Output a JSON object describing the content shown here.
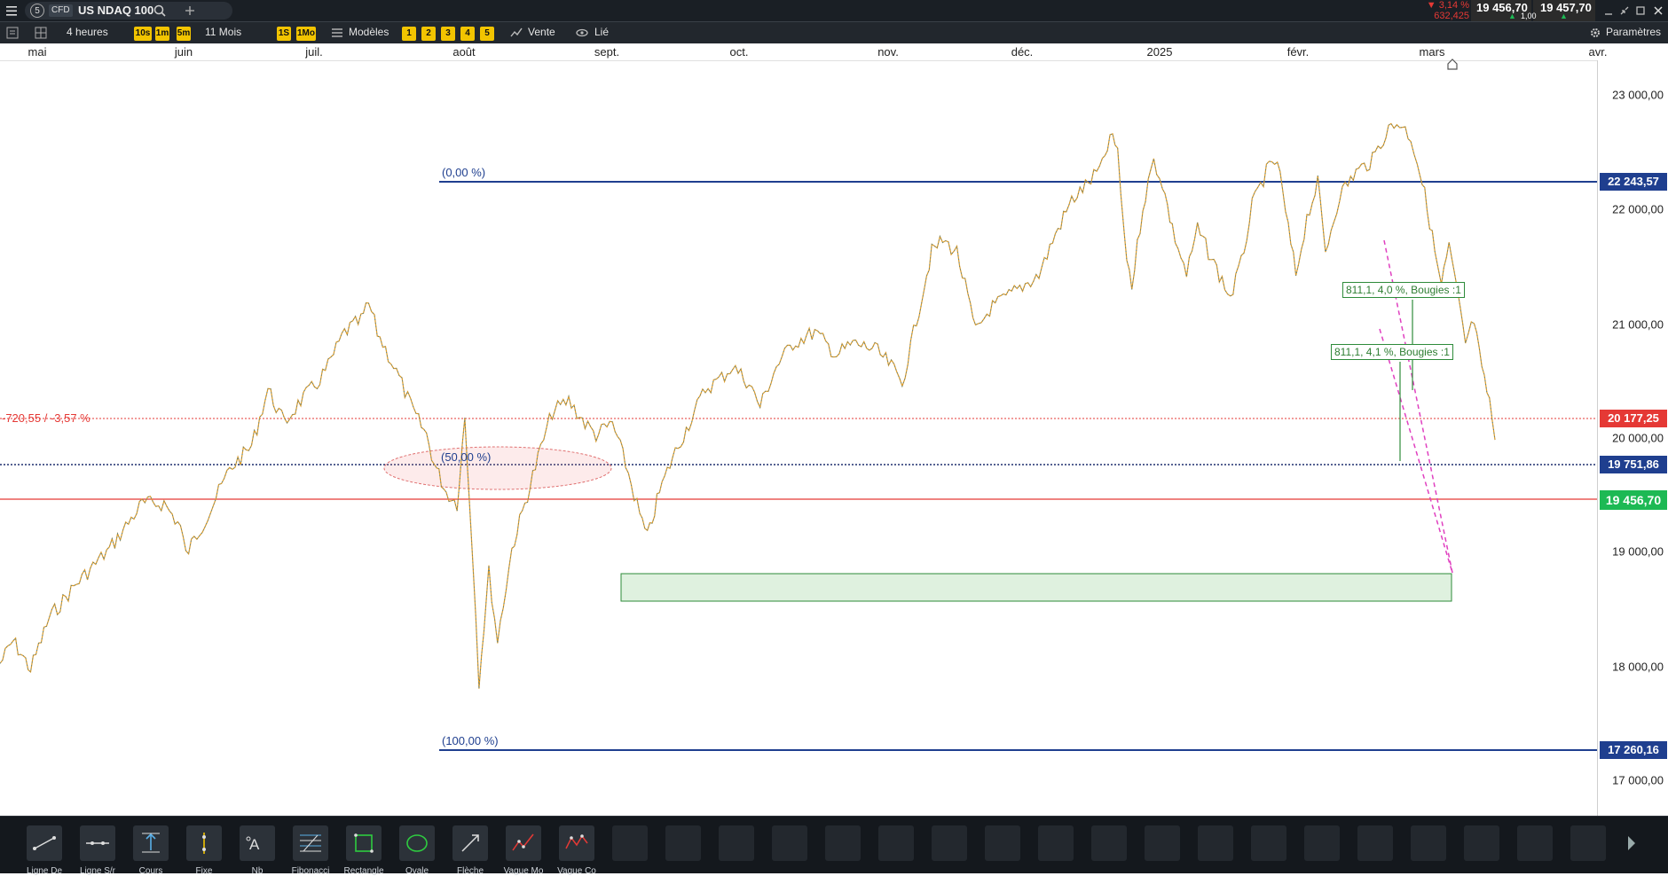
{
  "header": {
    "slot_number": "5",
    "instrument_type": "CFD",
    "instrument_name": "US NDAQ 100",
    "search_icon": "search-icon",
    "add_tab_icon": "plus-icon",
    "change_pct": "▼ 3,14 %",
    "change_abs": "632,425",
    "bid": "19 456,70",
    "ask": "19 457,70",
    "spread": "1,00",
    "colors": {
      "down": "#e53935",
      "up": "#1db954",
      "bid_bg": "#2b2b2b"
    }
  },
  "toolbar": {
    "interval": "4 heures",
    "interval_buttons": [
      "10s",
      "1m",
      "5m"
    ],
    "period": "11 Mois",
    "period_buttons": [
      "1S",
      "1Mo"
    ],
    "templates": "Modèles",
    "number_buttons": [
      "1",
      "2",
      "3",
      "4",
      "5"
    ],
    "trade": "Vente",
    "linked": "Lié",
    "settings": "Paramètres"
  },
  "months": [
    "mai",
    "juin",
    "juil.",
    "août",
    "sept.",
    "oct.",
    "nov.",
    "déc.",
    "2025",
    "févr.",
    "mars",
    "avr."
  ],
  "y_axis_labels": [
    "23 000,00",
    "22 000,00",
    "21 000,00",
    "20 000,00",
    "19 000,00",
    "18 000,00",
    "17 000,00"
  ],
  "price_tags": {
    "fib_top": "22 243,57",
    "alert": "20 177,25",
    "dotted": "19 751,86",
    "current": "19 456,70",
    "fib_bottom": "17 260,16"
  },
  "annotations": {
    "fib_0": "(0,00 %)",
    "fib_50": "(50,00 %)",
    "fib_100": "(100,00 %)",
    "alert_diff": "-720,55 / -3,57 %",
    "measure_1": "811,1, 4,0 %, Bougies :1",
    "measure_2": "811,1, 4,1 %, Bougies :1"
  },
  "chart_data": {
    "type": "line",
    "title": "US NDAQ 100",
    "interval": "4 heures",
    "x": [
      "mai",
      "juin",
      "juil.",
      "août",
      "sept.",
      "oct.",
      "nov.",
      "déc.",
      "2025",
      "févr.",
      "mars"
    ],
    "ylim": [
      16850,
      23200
    ],
    "series": [
      {
        "name": "US NDAQ 100",
        "values": [
          17600,
          18800,
          19600,
          18000,
          19200,
          19900,
          20200,
          21200,
          21500,
          21800,
          19456.7
        ]
      }
    ],
    "points": [
      [
        0,
        17500
      ],
      [
        12,
        17700
      ],
      [
        28,
        17450
      ],
      [
        45,
        17900
      ],
      [
        70,
        18200
      ],
      [
        100,
        18500
      ],
      [
        130,
        18900
      ],
      [
        150,
        18900
      ],
      [
        165,
        18700
      ],
      [
        170,
        18450
      ],
      [
        190,
        18800
      ],
      [
        210,
        19200
      ],
      [
        230,
        19400
      ],
      [
        245,
        19900
      ],
      [
        260,
        19600
      ],
      [
        275,
        19800
      ],
      [
        290,
        19950
      ],
      [
        300,
        20100
      ],
      [
        315,
        20400
      ],
      [
        330,
        20500
      ],
      [
        337,
        20650
      ],
      [
        345,
        20400
      ],
      [
        355,
        20200
      ],
      [
        365,
        20000
      ],
      [
        378,
        19700
      ],
      [
        390,
        19500
      ],
      [
        397,
        19250
      ],
      [
        408,
        19000
      ],
      [
        418,
        18900
      ],
      [
        425,
        19650
      ],
      [
        432,
        18500
      ],
      [
        438,
        17350
      ],
      [
        447,
        18300
      ],
      [
        455,
        17700
      ],
      [
        468,
        18500
      ],
      [
        480,
        18900
      ],
      [
        492,
        19300
      ],
      [
        505,
        19700
      ],
      [
        520,
        19800
      ],
      [
        535,
        19600
      ],
      [
        545,
        19500
      ],
      [
        560,
        19600
      ],
      [
        572,
        19250
      ],
      [
        585,
        18800
      ],
      [
        592,
        18600
      ],
      [
        603,
        19000
      ],
      [
        615,
        19300
      ],
      [
        630,
        19600
      ],
      [
        645,
        19900
      ],
      [
        660,
        20000
      ],
      [
        670,
        20100
      ],
      [
        685,
        19950
      ],
      [
        695,
        19750
      ],
      [
        710,
        20100
      ],
      [
        725,
        20300
      ],
      [
        745,
        20400
      ],
      [
        765,
        20200
      ],
      [
        780,
        20300
      ],
      [
        800,
        20250
      ],
      [
        815,
        20100
      ],
      [
        825,
        19950
      ],
      [
        838,
        20500
      ],
      [
        852,
        21100
      ],
      [
        862,
        21200
      ],
      [
        875,
        21100
      ],
      [
        885,
        20700
      ],
      [
        892,
        20400
      ],
      [
        905,
        20600
      ],
      [
        920,
        20700
      ],
      [
        935,
        20800
      ],
      [
        950,
        20900
      ],
      [
        965,
        21250
      ],
      [
        980,
        21550
      ],
      [
        995,
        21700
      ],
      [
        1008,
        21850
      ],
      [
        1015,
        22100
      ],
      [
        1022,
        22000
      ],
      [
        1028,
        21200
      ],
      [
        1035,
        20800
      ],
      [
        1045,
        21500
      ],
      [
        1055,
        21900
      ],
      [
        1063,
        21700
      ],
      [
        1072,
        21300
      ],
      [
        1085,
        20900
      ],
      [
        1095,
        21300
      ],
      [
        1105,
        21100
      ],
      [
        1115,
        20900
      ],
      [
        1125,
        20700
      ],
      [
        1135,
        21000
      ],
      [
        1145,
        21500
      ],
      [
        1158,
        21800
      ],
      [
        1168,
        21900
      ],
      [
        1178,
        21300
      ],
      [
        1185,
        20900
      ],
      [
        1195,
        21400
      ],
      [
        1205,
        21700
      ],
      [
        1212,
        21100
      ],
      [
        1225,
        21600
      ],
      [
        1240,
        21800
      ],
      [
        1255,
        21900
      ],
      [
        1265,
        22100
      ],
      [
        1272,
        22200
      ],
      [
        1280,
        22230
      ],
      [
        1290,
        22100
      ],
      [
        1296,
        21900
      ],
      [
        1305,
        21500
      ],
      [
        1312,
        21100
      ],
      [
        1318,
        20800
      ],
      [
        1325,
        21150
      ],
      [
        1333,
        20700
      ],
      [
        1340,
        20300
      ],
      [
        1348,
        20500
      ],
      [
        1355,
        20050
      ],
      [
        1362,
        19800
      ],
      [
        1367,
        19456.7
      ]
    ]
  },
  "tools": [
    {
      "label": "Ligne De",
      "icon": "trend-line-icon"
    },
    {
      "label": "Ligne S/r",
      "icon": "support-resistance-icon"
    },
    {
      "label": "Cours",
      "icon": "price-range-icon"
    },
    {
      "label": "Fixe",
      "icon": "fixed-line-icon"
    },
    {
      "label": "Nb",
      "icon": "text-note-icon"
    },
    {
      "label": "Fibonacci",
      "icon": "fibonacci-icon"
    },
    {
      "label": "Rectangle",
      "icon": "rectangle-icon"
    },
    {
      "label": "Ovale",
      "icon": "ellipse-icon"
    },
    {
      "label": "Flèche",
      "icon": "arrow-icon"
    },
    {
      "label": "Vague Mo",
      "icon": "wave-motive-icon"
    },
    {
      "label": "Vague Co",
      "icon": "wave-corrective-icon"
    }
  ]
}
